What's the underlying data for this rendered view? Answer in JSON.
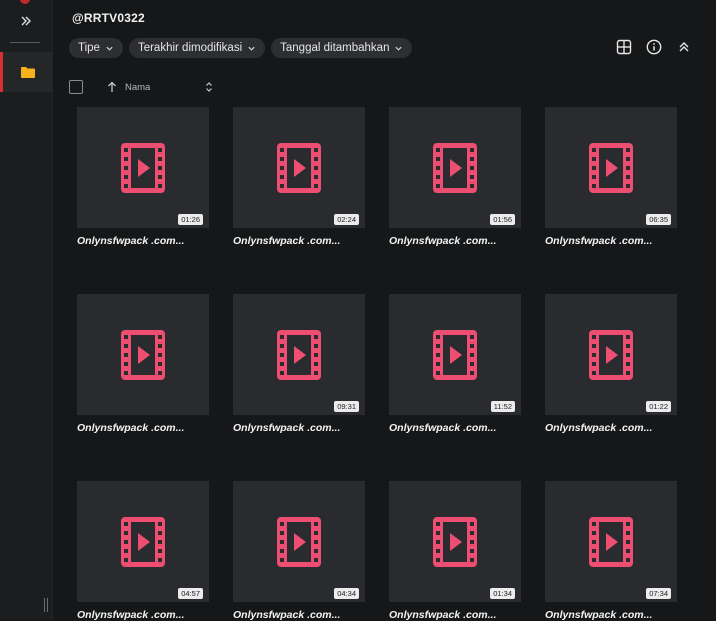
{
  "header": {
    "title": "@RRTV0322"
  },
  "filters": [
    {
      "label": "Tipe"
    },
    {
      "label": "Terakhir dimodifikasi"
    },
    {
      "label": "Tanggal ditambahkan"
    }
  ],
  "sort": {
    "label": "Nama"
  },
  "colors": {
    "accent": "#d9302f",
    "folder": "#f5b21a",
    "video_icon": "#ee4e72"
  },
  "files": [
    {
      "name": "Onlynsfwpack .com...",
      "duration": "01:26"
    },
    {
      "name": "Onlynsfwpack .com...",
      "duration": "02:24"
    },
    {
      "name": "Onlynsfwpack .com...",
      "duration": "01:56"
    },
    {
      "name": "Onlynsfwpack .com...",
      "duration": "06:35"
    },
    {
      "name": "Onlynsfwpack .com...",
      "duration": ""
    },
    {
      "name": "Onlynsfwpack .com...",
      "duration": "09:31"
    },
    {
      "name": "Onlynsfwpack .com...",
      "duration": "11:52"
    },
    {
      "name": "Onlynsfwpack .com...",
      "duration": "01:22"
    },
    {
      "name": "Onlynsfwpack .com...",
      "duration": "04:57"
    },
    {
      "name": "Onlynsfwpack .com...",
      "duration": "04:34"
    },
    {
      "name": "Onlynsfwpack .com...",
      "duration": "01:34"
    },
    {
      "name": "Onlynsfwpack .com...",
      "duration": "07:34"
    }
  ]
}
